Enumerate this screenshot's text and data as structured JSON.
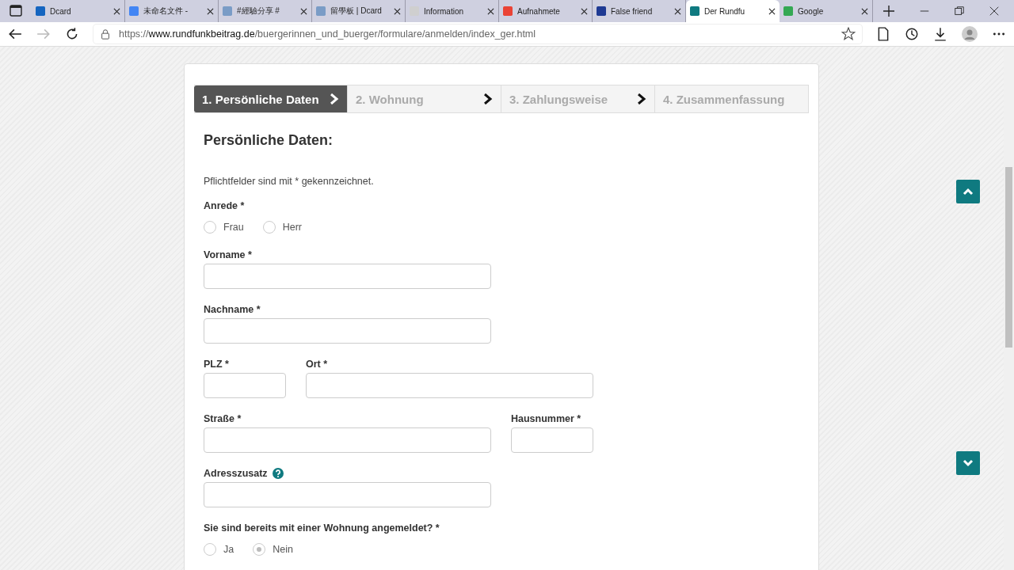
{
  "browser": {
    "tabs": [
      {
        "title": "Dcard",
        "selected": false,
        "color": "#1565c0"
      },
      {
        "title": "未命名文件 -",
        "selected": false,
        "color": "#4285f4"
      },
      {
        "title": "#經驗分享 #",
        "selected": false,
        "color": "#7a9cc6"
      },
      {
        "title": "留學板 | Dcard",
        "selected": false,
        "color": "#7a9cc6"
      },
      {
        "title": "Information",
        "selected": false,
        "color": "#cfcfcf"
      },
      {
        "title": "Aufnahmete",
        "selected": false,
        "color": "#ea4335"
      },
      {
        "title": "False friend",
        "selected": false,
        "color": "#1f3a93"
      },
      {
        "title": "Der Rundfu",
        "selected": true,
        "color": "#0f7a80"
      },
      {
        "title": "Google",
        "selected": false,
        "color": "#34a853"
      }
    ],
    "url": "https://**www.rundfunkbeitrag.de**/buergerinnen_und_buerger/formulare/anmelden/index_ger.html"
  },
  "steps": [
    {
      "label": "1. Persönliche Daten",
      "selected": true
    },
    {
      "label": "2. Wohnung",
      "selected": false
    },
    {
      "label": "3. Zahlungsweise",
      "selected": false
    },
    {
      "label": "4. Zusammenfassung",
      "selected": false
    }
  ],
  "form": {
    "heading": "Persönliche Daten:",
    "note": "Pflichtfelder sind mit * gekennzeichnet.",
    "rows": [
      [
        {
          "kind": "radio",
          "label": "Anrede *",
          "options": [
            {
              "label": "Frau",
              "selected": false
            },
            {
              "label": "Herr",
              "selected": false
            }
          ]
        }
      ],
      [
        {
          "kind": "text",
          "label": "Vorname *"
        }
      ],
      [
        {
          "kind": "text",
          "label": "Nachname *"
        }
      ],
      [
        {
          "kind": "text-short",
          "label": "PLZ *"
        },
        {
          "kind": "text",
          "label": "Ort *"
        }
      ],
      [
        {
          "kind": "text",
          "label": "Straße *"
        },
        {
          "kind": "text-short",
          "label": "Hausnummer *"
        }
      ],
      [
        {
          "kind": "text",
          "label": "Adresszusatz",
          "help": true
        }
      ],
      [
        {
          "kind": "radio",
          "label": "Sie sind bereits mit einer Wohnung angemeldet? *",
          "options": [
            {
              "label": "Ja",
              "selected": false
            },
            {
              "label": "Nein",
              "selected": true
            }
          ]
        }
      ]
    ]
  }
}
